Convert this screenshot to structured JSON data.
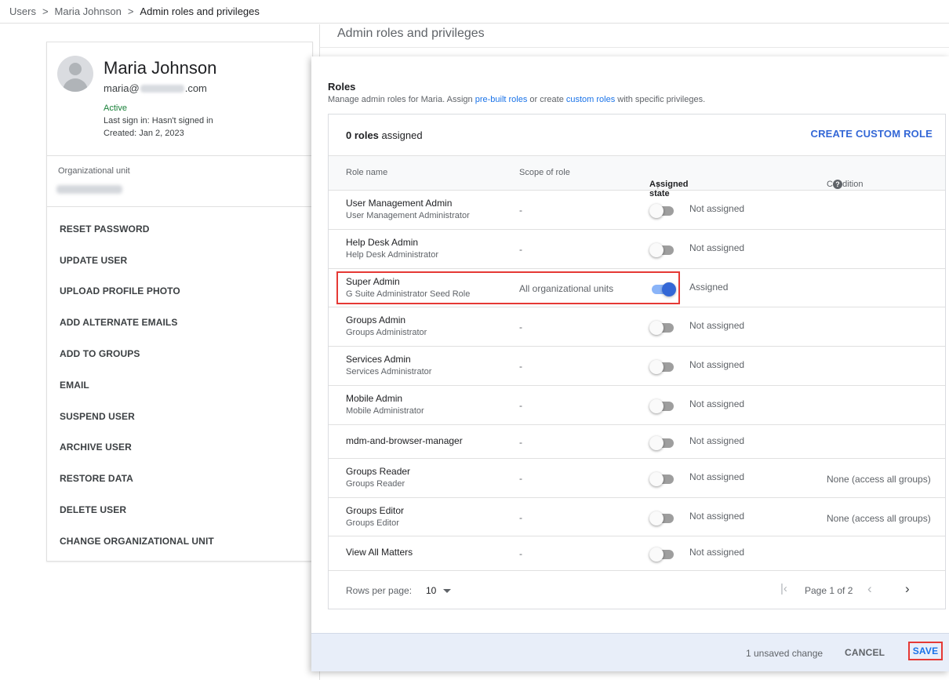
{
  "breadcrumb": {
    "items": [
      "Users",
      "Maria Johnson",
      "Admin roles and privileges"
    ],
    "separator": ">"
  },
  "user": {
    "name": "Maria Johnson",
    "email_prefix": "maria@",
    "email_suffix": ".com",
    "status": "Active",
    "last_sign_in": "Last sign in: Hasn't signed in",
    "created": "Created: Jan 2, 2023",
    "org_unit_label": "Organizational unit"
  },
  "actions": [
    "RESET PASSWORD",
    "UPDATE USER",
    "UPLOAD PROFILE PHOTO",
    "ADD ALTERNATE EMAILS",
    "ADD TO GROUPS",
    "EMAIL",
    "SUSPEND USER",
    "ARCHIVE USER",
    "RESTORE DATA",
    "DELETE USER",
    "CHANGE ORGANIZATIONAL UNIT"
  ],
  "background_title": "Admin roles and privileges",
  "roles": {
    "title": "Roles",
    "desc_prefix": "Manage admin roles for Maria. Assign ",
    "desc_link1": "pre-built roles",
    "desc_middle": " or create ",
    "desc_link2": "custom roles",
    "desc_suffix": " with specific privileges.",
    "count_bold": "0 roles",
    "count_rest": " assigned",
    "create_custom": "CREATE CUSTOM ROLE",
    "columns": {
      "name": "Role name",
      "scope": "Scope of role",
      "assigned": "Assigned state",
      "condition": "Condition"
    },
    "rows": [
      {
        "name": "User Management Admin",
        "sub": "User Management Administrator",
        "scope": "-",
        "state": "Not assigned",
        "on": false,
        "condition": ""
      },
      {
        "name": "Help Desk Admin",
        "sub": "Help Desk Administrator",
        "scope": "-",
        "state": "Not assigned",
        "on": false,
        "condition": ""
      },
      {
        "name": "Super Admin",
        "sub": "G Suite Administrator Seed Role",
        "scope": "All organizational units",
        "state": "Assigned",
        "on": true,
        "condition": "",
        "highlight": true
      },
      {
        "name": "Groups Admin",
        "sub": "Groups Administrator",
        "scope": "-",
        "state": "Not assigned",
        "on": false,
        "condition": ""
      },
      {
        "name": "Services Admin",
        "sub": "Services Administrator",
        "scope": "-",
        "state": "Not assigned",
        "on": false,
        "condition": ""
      },
      {
        "name": "Mobile Admin",
        "sub": "Mobile Administrator",
        "scope": "-",
        "state": "Not assigned",
        "on": false,
        "condition": ""
      },
      {
        "name": "mdm-and-browser-manager",
        "sub": "",
        "scope": "-",
        "state": "Not assigned",
        "on": false,
        "condition": ""
      },
      {
        "name": "Groups Reader",
        "sub": "Groups Reader",
        "scope": "-",
        "state": "Not assigned",
        "on": false,
        "condition": "None (access all groups)"
      },
      {
        "name": "Groups Editor",
        "sub": "Groups Editor",
        "scope": "-",
        "state": "Not assigned",
        "on": false,
        "condition": "None (access all groups)"
      },
      {
        "name": "View All Matters",
        "sub": "",
        "scope": "-",
        "state": "Not assigned",
        "on": false,
        "condition": ""
      }
    ],
    "pagination": {
      "rows_per_page_label": "Rows per page:",
      "rows_per_page": "10",
      "page_info": "Page 1 of 2"
    }
  },
  "footer": {
    "unsaved": "1 unsaved change",
    "cancel": "CANCEL",
    "save": "SAVE"
  },
  "colors": {
    "accent": "#3367d6",
    "highlight": "#e53935",
    "active_status": "#188038",
    "footer_bg": "#e8eef9"
  },
  "icons": {
    "first_page": "first-page-icon",
    "prev": "chevron-left-icon",
    "next": "chevron-right-icon",
    "sort": "arrow-up-icon",
    "help": "help-icon"
  }
}
